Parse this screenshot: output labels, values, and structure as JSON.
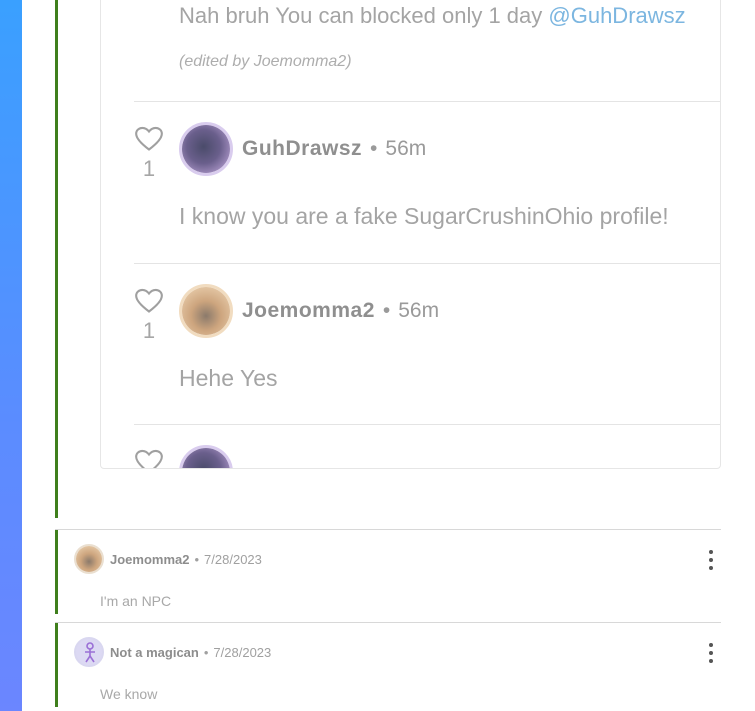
{
  "thread": {
    "top_reply": {
      "text": "Nah bruh You can blocked only 1 day ",
      "mention": "@GuhDrawsz",
      "edited_note": "(edited by Joemomma2)"
    },
    "replies": [
      {
        "author": "GuhDrawsz",
        "time": "56m",
        "likes": "1",
        "text": "I know you are a fake SugarCrushinOhio profile!",
        "avatar": "purple"
      },
      {
        "author": "Joemomma2",
        "time": "56m",
        "likes": "1",
        "text": "Hehe Yes",
        "avatar": "orange"
      }
    ]
  },
  "comments": [
    {
      "author": "Joemomma2",
      "date": "7/28/2023",
      "text": "I'm an NPC",
      "avatar": "orange"
    },
    {
      "author": "Not a magican",
      "date": "7/28/2023",
      "text": "We know",
      "avatar": "lavender"
    }
  ],
  "icons": {
    "like": "heart-icon",
    "more": "more-vertical-icon"
  },
  "colors": {
    "thread_line": "#3f7f1c",
    "mention": "#7cb6e0",
    "stripe": "#5b8cff"
  }
}
